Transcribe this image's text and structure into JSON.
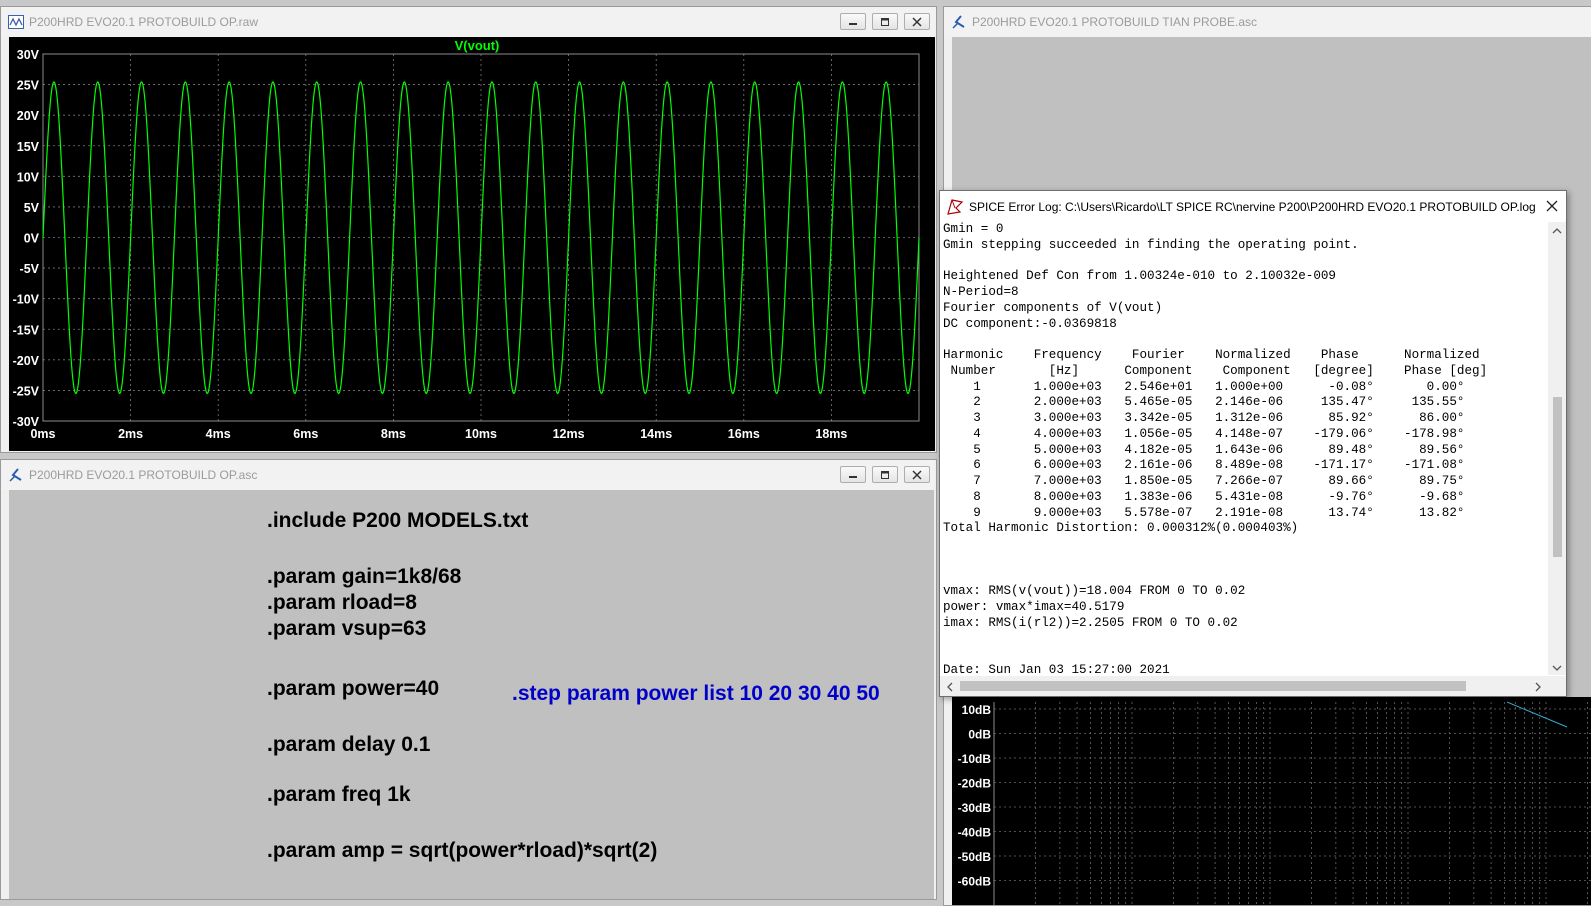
{
  "waveform_window": {
    "title": "P200HRD EVO20.1 PROTOBUILD OP.raw",
    "trace_label": "V(vout)",
    "y_ticks": [
      "30V",
      "25V",
      "20V",
      "15V",
      "10V",
      "5V",
      "0V",
      "-5V",
      "-10V",
      "-15V",
      "-20V",
      "-25V",
      "-30V"
    ],
    "x_ticks": [
      "0ms",
      "2ms",
      "4ms",
      "6ms",
      "8ms",
      "10ms",
      "12ms",
      "14ms",
      "16ms",
      "18ms"
    ],
    "trace_color": "#00ff00"
  },
  "chart_data": {
    "type": "line",
    "title": "V(vout)",
    "xlabel": "",
    "ylabel": "",
    "xlim_ms": [
      0,
      20
    ],
    "ylim": [
      -30,
      30
    ],
    "grid": true,
    "series": [
      {
        "name": "V(vout)",
        "waveform": "sine",
        "frequency_hz": 1000,
        "amplitude": 25.46,
        "dc_offset": -0.037
      }
    ]
  },
  "asc_window": {
    "title": "P200HRD EVO20.1 PROTOBUILD OP.asc",
    "lines": [
      ".include P200 MODELS.txt",
      ".param gain=1k8/68",
      ".param rload=8",
      ".param vsup=63",
      ".param power=40",
      ".param delay 0.1",
      ".param freq 1k",
      ".param amp = sqrt(power*rload)*sqrt(2)"
    ],
    "step_directive": ".step param power list 10 20 30 40 50",
    "step_color": "#0000c8"
  },
  "probe_window": {
    "title": "P200HRD EVO20.1 PROTOBUILD TIAN PROBE.asc",
    "db_ticks": [
      "10dB",
      "0dB",
      "-10dB",
      "-20dB",
      "-30dB",
      "-40dB",
      "-50dB",
      "-60dB"
    ]
  },
  "error_log": {
    "title": "SPICE Error Log: C:\\Users\\Ricardo\\LT SPICE RC\\nervine P200\\P200HRD EVO20.1 PROTOBUILD OP.log",
    "lines": [
      "Gmin = 0",
      "Gmin stepping succeeded in finding the operating point.",
      "",
      "Heightened Def Con from 1.00324e-010 to 2.10032e-009",
      "N-Period=8",
      "Fourier components of V(vout)",
      "DC component:-0.0369818",
      "",
      "Harmonic    Frequency    Fourier    Normalized    Phase      Normalized",
      " Number       [Hz]      Component    Component   [degree]    Phase [deg]",
      "    1       1.000e+03   2.546e+01   1.000e+00      -0.08°       0.00°",
      "    2       2.000e+03   5.465e-05   2.146e-06     135.47°     135.55°",
      "    3       3.000e+03   3.342e-05   1.312e-06      85.92°      86.00°",
      "    4       4.000e+03   1.056e-05   4.148e-07    -179.06°    -178.98°",
      "    5       5.000e+03   4.182e-05   1.643e-06      89.48°      89.56°",
      "    6       6.000e+03   2.161e-06   8.489e-08    -171.17°    -171.08°",
      "    7       7.000e+03   1.850e-05   7.266e-07      89.66°      89.75°",
      "    8       8.000e+03   1.383e-06   5.431e-08      -9.76°      -9.68°",
      "    9       9.000e+03   5.578e-07   2.191e-08      13.74°      13.82°",
      "Total Harmonic Distortion: 0.000312%(0.000403%)",
      "",
      "",
      "",
      "vmax: RMS(v(vout))=18.004 FROM 0 TO 0.02",
      "power: vmax*imax=40.5179",
      "imax: RMS(i(rl2))=2.2505 FROM 0 TO 0.02",
      "",
      "",
      "Date: Sun Jan 03 15:27:00 2021"
    ]
  }
}
